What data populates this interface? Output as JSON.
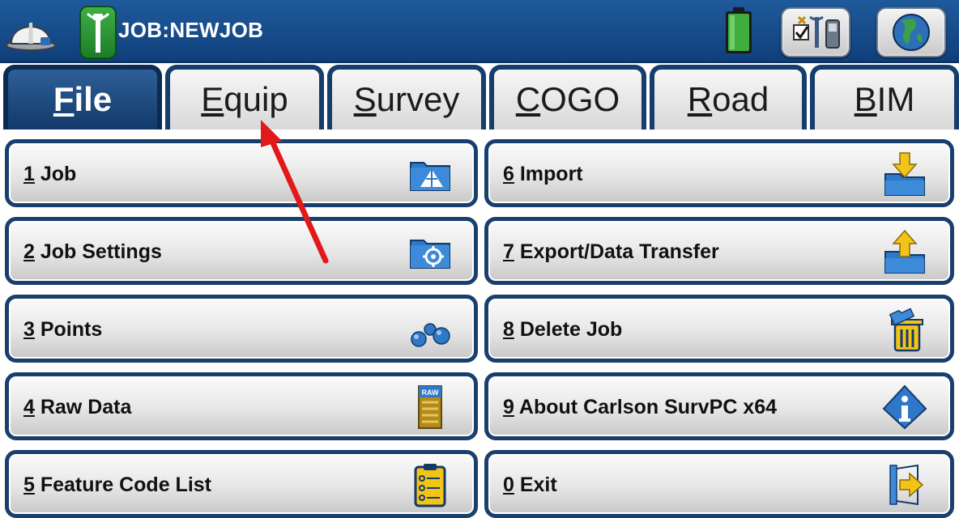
{
  "header": {
    "job_title": "JOB:NEWJOB",
    "icons": {
      "hardhat": "hardhat-icon",
      "antenna": "gps-antenna-icon",
      "battery": "battery-icon",
      "equip": "equipment-status-icon",
      "globe": "globe-icon"
    }
  },
  "tabs": [
    {
      "hot": "F",
      "rest": "ile",
      "active": true
    },
    {
      "hot": "E",
      "rest": "quip",
      "active": false
    },
    {
      "hot": "S",
      "rest": "urvey",
      "active": false
    },
    {
      "hot": "C",
      "rest": "OGO",
      "active": false
    },
    {
      "hot": "R",
      "rest": "oad",
      "active": false
    },
    {
      "hot": "B",
      "rest": "IM",
      "active": false
    }
  ],
  "menu": {
    "left": [
      {
        "num": "1",
        "text": " Job",
        "icon": "job-folder-icon"
      },
      {
        "num": "2",
        "text": " Job Settings",
        "icon": "job-settings-folder-icon"
      },
      {
        "num": "3",
        "text": " Points",
        "icon": "points-icon"
      },
      {
        "num": "4",
        "text": " Raw Data",
        "icon": "raw-data-icon",
        "icon_text": "RAW"
      },
      {
        "num": "5",
        "text": " Feature Code List",
        "icon": "feature-code-list-icon"
      }
    ],
    "right": [
      {
        "num": "6",
        "text": " Import",
        "icon": "import-icon"
      },
      {
        "num": "7",
        "text": " Export/Data Transfer",
        "icon": "export-icon"
      },
      {
        "num": "8",
        "text": " Delete Job",
        "icon": "delete-job-icon"
      },
      {
        "num": "9",
        "text": " About Carlson SurvPC x64",
        "icon": "about-info-icon"
      },
      {
        "num": "0",
        "text": " Exit",
        "icon": "exit-icon"
      }
    ]
  },
  "colors": {
    "header_blue": "#1a4f8c",
    "button_border": "#183f6e",
    "annotation_red": "#e11919"
  }
}
